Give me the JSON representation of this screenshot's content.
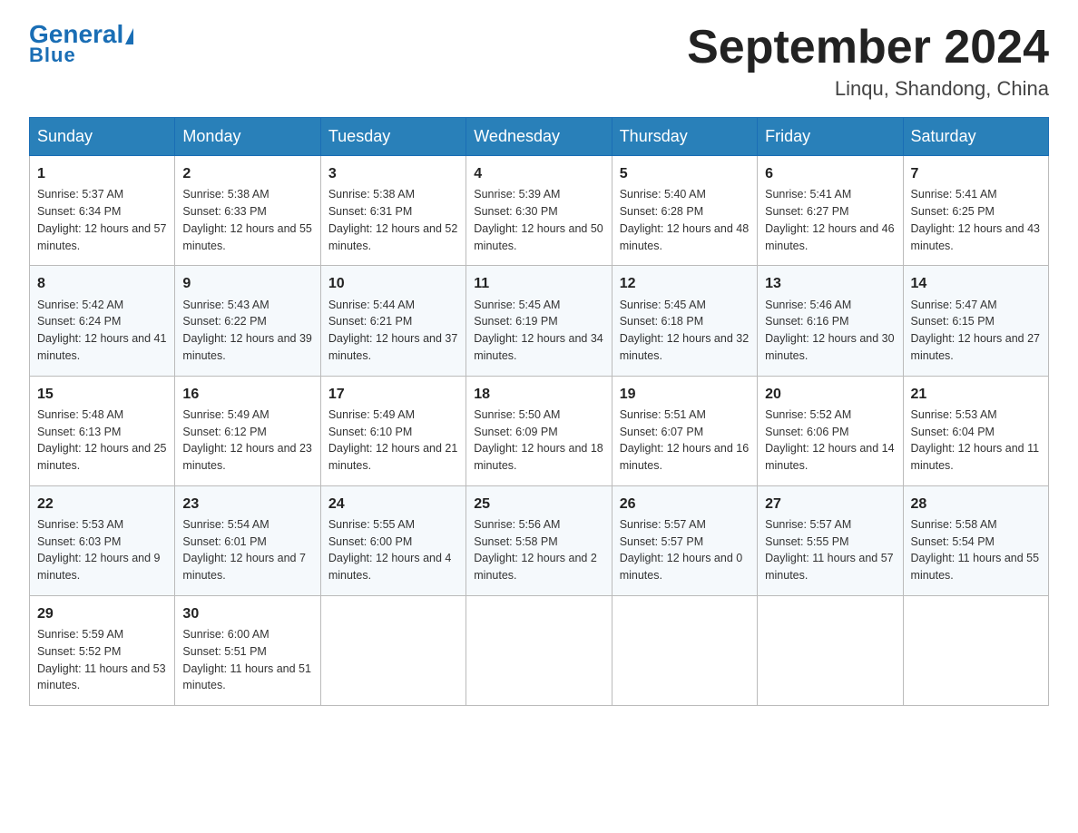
{
  "header": {
    "logo_general": "General",
    "logo_blue": "Blue",
    "month_title": "September 2024",
    "location": "Linqu, Shandong, China"
  },
  "days_of_week": [
    "Sunday",
    "Monday",
    "Tuesday",
    "Wednesday",
    "Thursday",
    "Friday",
    "Saturday"
  ],
  "weeks": [
    [
      {
        "day": "1",
        "sunrise": "5:37 AM",
        "sunset": "6:34 PM",
        "daylight": "12 hours and 57 minutes."
      },
      {
        "day": "2",
        "sunrise": "5:38 AM",
        "sunset": "6:33 PM",
        "daylight": "12 hours and 55 minutes."
      },
      {
        "day": "3",
        "sunrise": "5:38 AM",
        "sunset": "6:31 PM",
        "daylight": "12 hours and 52 minutes."
      },
      {
        "day": "4",
        "sunrise": "5:39 AM",
        "sunset": "6:30 PM",
        "daylight": "12 hours and 50 minutes."
      },
      {
        "day": "5",
        "sunrise": "5:40 AM",
        "sunset": "6:28 PM",
        "daylight": "12 hours and 48 minutes."
      },
      {
        "day": "6",
        "sunrise": "5:41 AM",
        "sunset": "6:27 PM",
        "daylight": "12 hours and 46 minutes."
      },
      {
        "day": "7",
        "sunrise": "5:41 AM",
        "sunset": "6:25 PM",
        "daylight": "12 hours and 43 minutes."
      }
    ],
    [
      {
        "day": "8",
        "sunrise": "5:42 AM",
        "sunset": "6:24 PM",
        "daylight": "12 hours and 41 minutes."
      },
      {
        "day": "9",
        "sunrise": "5:43 AM",
        "sunset": "6:22 PM",
        "daylight": "12 hours and 39 minutes."
      },
      {
        "day": "10",
        "sunrise": "5:44 AM",
        "sunset": "6:21 PM",
        "daylight": "12 hours and 37 minutes."
      },
      {
        "day": "11",
        "sunrise": "5:45 AM",
        "sunset": "6:19 PM",
        "daylight": "12 hours and 34 minutes."
      },
      {
        "day": "12",
        "sunrise": "5:45 AM",
        "sunset": "6:18 PM",
        "daylight": "12 hours and 32 minutes."
      },
      {
        "day": "13",
        "sunrise": "5:46 AM",
        "sunset": "6:16 PM",
        "daylight": "12 hours and 30 minutes."
      },
      {
        "day": "14",
        "sunrise": "5:47 AM",
        "sunset": "6:15 PM",
        "daylight": "12 hours and 27 minutes."
      }
    ],
    [
      {
        "day": "15",
        "sunrise": "5:48 AM",
        "sunset": "6:13 PM",
        "daylight": "12 hours and 25 minutes."
      },
      {
        "day": "16",
        "sunrise": "5:49 AM",
        "sunset": "6:12 PM",
        "daylight": "12 hours and 23 minutes."
      },
      {
        "day": "17",
        "sunrise": "5:49 AM",
        "sunset": "6:10 PM",
        "daylight": "12 hours and 21 minutes."
      },
      {
        "day": "18",
        "sunrise": "5:50 AM",
        "sunset": "6:09 PM",
        "daylight": "12 hours and 18 minutes."
      },
      {
        "day": "19",
        "sunrise": "5:51 AM",
        "sunset": "6:07 PM",
        "daylight": "12 hours and 16 minutes."
      },
      {
        "day": "20",
        "sunrise": "5:52 AM",
        "sunset": "6:06 PM",
        "daylight": "12 hours and 14 minutes."
      },
      {
        "day": "21",
        "sunrise": "5:53 AM",
        "sunset": "6:04 PM",
        "daylight": "12 hours and 11 minutes."
      }
    ],
    [
      {
        "day": "22",
        "sunrise": "5:53 AM",
        "sunset": "6:03 PM",
        "daylight": "12 hours and 9 minutes."
      },
      {
        "day": "23",
        "sunrise": "5:54 AM",
        "sunset": "6:01 PM",
        "daylight": "12 hours and 7 minutes."
      },
      {
        "day": "24",
        "sunrise": "5:55 AM",
        "sunset": "6:00 PM",
        "daylight": "12 hours and 4 minutes."
      },
      {
        "day": "25",
        "sunrise": "5:56 AM",
        "sunset": "5:58 PM",
        "daylight": "12 hours and 2 minutes."
      },
      {
        "day": "26",
        "sunrise": "5:57 AM",
        "sunset": "5:57 PM",
        "daylight": "12 hours and 0 minutes."
      },
      {
        "day": "27",
        "sunrise": "5:57 AM",
        "sunset": "5:55 PM",
        "daylight": "11 hours and 57 minutes."
      },
      {
        "day": "28",
        "sunrise": "5:58 AM",
        "sunset": "5:54 PM",
        "daylight": "11 hours and 55 minutes."
      }
    ],
    [
      {
        "day": "29",
        "sunrise": "5:59 AM",
        "sunset": "5:52 PM",
        "daylight": "11 hours and 53 minutes."
      },
      {
        "day": "30",
        "sunrise": "6:00 AM",
        "sunset": "5:51 PM",
        "daylight": "11 hours and 51 minutes."
      },
      null,
      null,
      null,
      null,
      null
    ]
  ],
  "labels": {
    "sunrise": "Sunrise:",
    "sunset": "Sunset:",
    "daylight": "Daylight:"
  }
}
